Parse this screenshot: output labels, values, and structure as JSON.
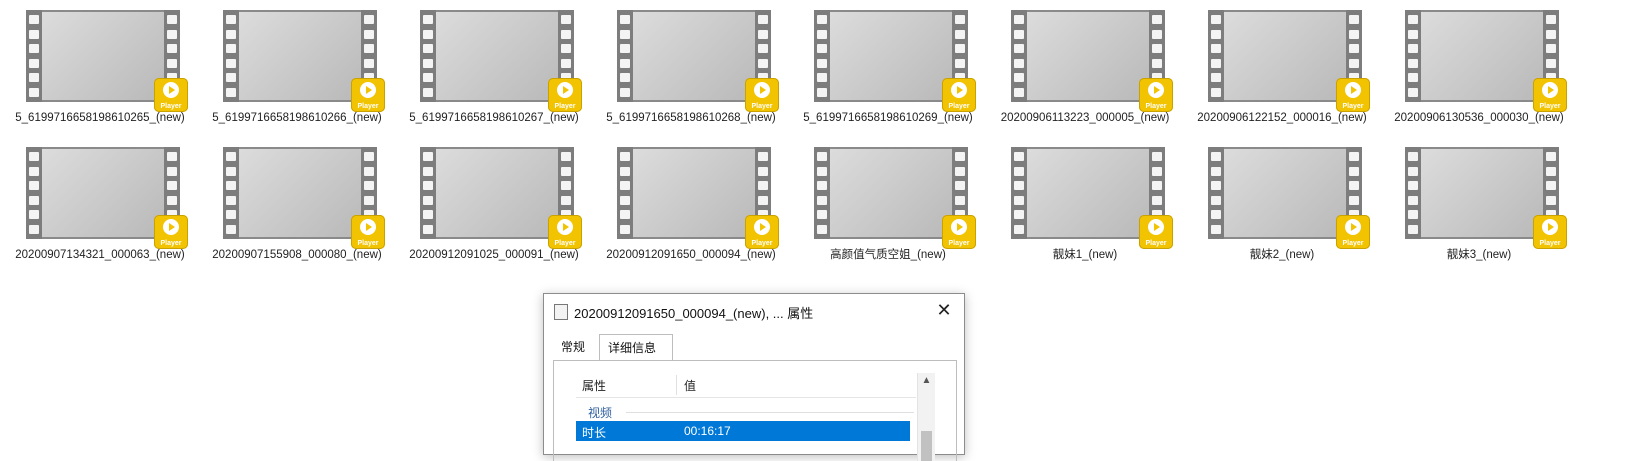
{
  "files": [
    {
      "name": "5_6199716658198610265_(new)",
      "badge": "Player"
    },
    {
      "name": "5_6199716658198610266_(new)",
      "badge": "Player"
    },
    {
      "name": "5_6199716658198610267_(new)",
      "badge": "Player"
    },
    {
      "name": "5_6199716658198610268_(new)",
      "badge": "Player"
    },
    {
      "name": "5_6199716658198610269_(new)",
      "badge": "Player"
    },
    {
      "name": "20200906113223_000005_(new)",
      "badge": "Player"
    },
    {
      "name": "20200906122152_000016_(new)",
      "badge": "Player"
    },
    {
      "name": "20200906130536_000030_(new)",
      "badge": "Player"
    },
    {
      "name": "20200907134321_000063_(new)",
      "badge": "Player"
    },
    {
      "name": "20200907155908_000080_(new)",
      "badge": "Player"
    },
    {
      "name": "20200912091025_000091_(new)",
      "badge": "Player"
    },
    {
      "name": "20200912091650_000094_(new)",
      "badge": "Player"
    },
    {
      "name": "高颜值气质空姐_(new)",
      "badge": "Player"
    },
    {
      "name": "靓妹1_(new)",
      "badge": "Player"
    },
    {
      "name": "靓妹2_(new)",
      "badge": "Player"
    },
    {
      "name": "靓妹3_(new)",
      "badge": "Player"
    }
  ],
  "dialog": {
    "title": "20200912091650_000094_(new), ... 属性",
    "close_glyph": "✕",
    "tabs": [
      "常规",
      "详细信息"
    ],
    "active_tab": "详细信息",
    "columns": [
      "属性",
      "值"
    ],
    "group": "视频",
    "rows": [
      {
        "key": "时长",
        "value": "00:16:17",
        "selected": true
      }
    ]
  },
  "colors": {
    "selection": "#0078d7",
    "badge": "#f2c300",
    "filmstrip": "#7d7d7d"
  }
}
